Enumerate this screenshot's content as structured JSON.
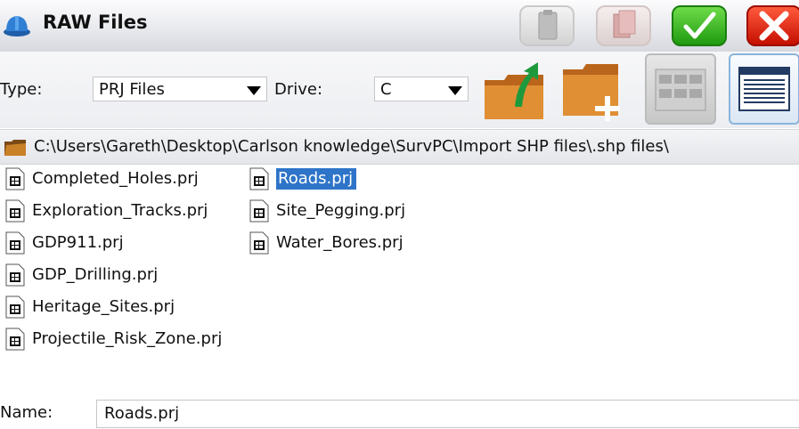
{
  "window": {
    "title": "RAW Files"
  },
  "toolbar": {
    "type_label": "Type:",
    "type_value": "PRJ Files",
    "drive_label": "Drive:",
    "drive_value": "C",
    "buttons": [
      "folder-up-icon",
      "new-folder-icon",
      "icon-view-icon",
      "list-view-icon"
    ]
  },
  "path": {
    "text": "C:\\Users\\Gareth\\Desktop\\Carlson knowledge\\SurvPC\\Import SHP files\\.shp files\\"
  },
  "files": {
    "col1": [
      "Completed_Holes.prj",
      "Exploration_Tracks.prj",
      "GDP911.prj",
      "GDP_Drilling.prj",
      "Heritage_Sites.prj",
      "Projectile_Risk_Zone.prj"
    ],
    "col2": [
      "Roads.prj",
      "Site_Pegging.prj",
      "Water_Bores.prj"
    ],
    "selected": "Roads.prj"
  },
  "name_field": {
    "label": "Name:",
    "value": "Roads.prj"
  },
  "colors": {
    "selection": "#2e74c8",
    "ok_green": "#1f9a10",
    "cancel_red": "#c50f00"
  }
}
